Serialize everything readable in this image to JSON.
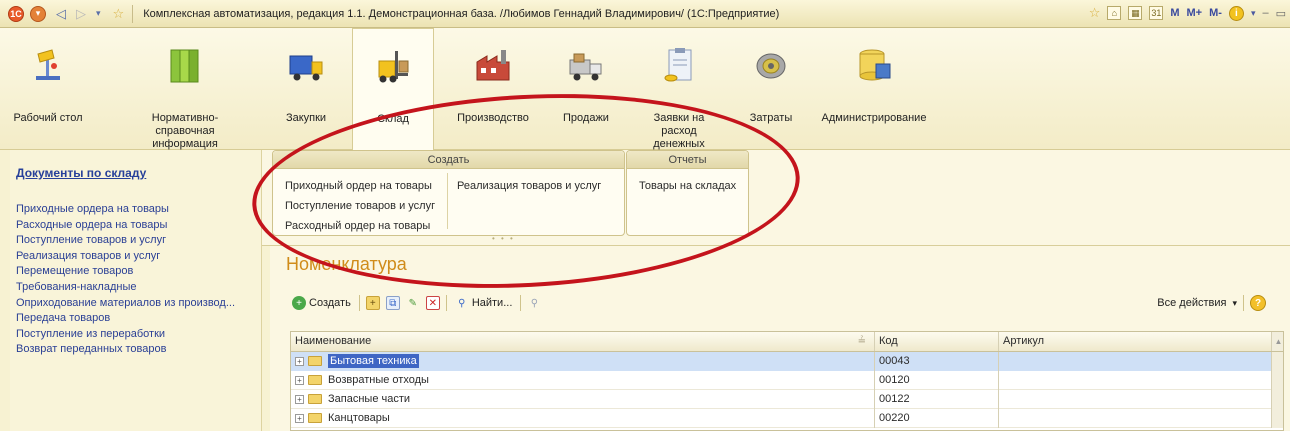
{
  "window": {
    "title": "Комплексная автоматизация, редакция 1.1. Демонстрационная база. /Любимов Геннадий Владимирович/  (1С:Предприятие)",
    "right_controls": [
      "M",
      "M+",
      "M-"
    ]
  },
  "sections": [
    {
      "label": "Рабочий стол",
      "icon": "desk-lamp-icon"
    },
    {
      "label": "Нормативно-справочная информация",
      "icon": "binders-icon"
    },
    {
      "label": "Закупки",
      "icon": "truck-icon"
    },
    {
      "label": "Склад",
      "icon": "forklift-icon",
      "active": true
    },
    {
      "label": "Производство",
      "icon": "factory-icon"
    },
    {
      "label": "Продажи",
      "icon": "delivery-van-icon"
    },
    {
      "label": "Заявки на расход денежных средств",
      "icon": "clipboard-coins-icon"
    },
    {
      "label": "Затраты",
      "icon": "coins-roll-icon"
    },
    {
      "label": "Администрирование",
      "icon": "database-icon"
    }
  ],
  "leftnav": {
    "heading": "Документы по складу",
    "items": [
      "Приходные ордера на товары",
      "Расходные ордера на товары",
      "Поступление товаров и услуг",
      "Реализация товаров и услуг",
      "Перемещение товаров",
      "Требования-накладные",
      "Оприходование материалов из производ...",
      "Передача товаров",
      "Поступление из переработки",
      "Возврат переданных товаров"
    ]
  },
  "actions": {
    "create": {
      "title": "Создать",
      "col1": [
        "Приходный ордер на товары",
        "Поступление товаров и услуг",
        "Расходный ордер на товары"
      ],
      "col2": [
        "Реализация товаров и услуг"
      ]
    },
    "reports": {
      "title": "Отчеты",
      "items": [
        "Товары на складах"
      ]
    }
  },
  "list": {
    "title": "Номенклатура",
    "toolbar": {
      "create": "Создать",
      "find": "Найти...",
      "all_actions": "Все действия"
    },
    "columns": [
      "Наименование",
      "Код",
      "Артикул"
    ],
    "rows": [
      {
        "name": "Бытовая техника",
        "code": "00043",
        "article": ""
      },
      {
        "name": "Возвратные отходы",
        "code": "00120",
        "article": ""
      },
      {
        "name": "Запасные части",
        "code": "00122",
        "article": ""
      },
      {
        "name": "Канцтовары",
        "code": "00220",
        "article": ""
      }
    ]
  },
  "colors": {
    "accent_blue": "#27409a",
    "list_title": "#d08c1a",
    "selection": "#3f66c4",
    "annotation": "#c4141c"
  }
}
